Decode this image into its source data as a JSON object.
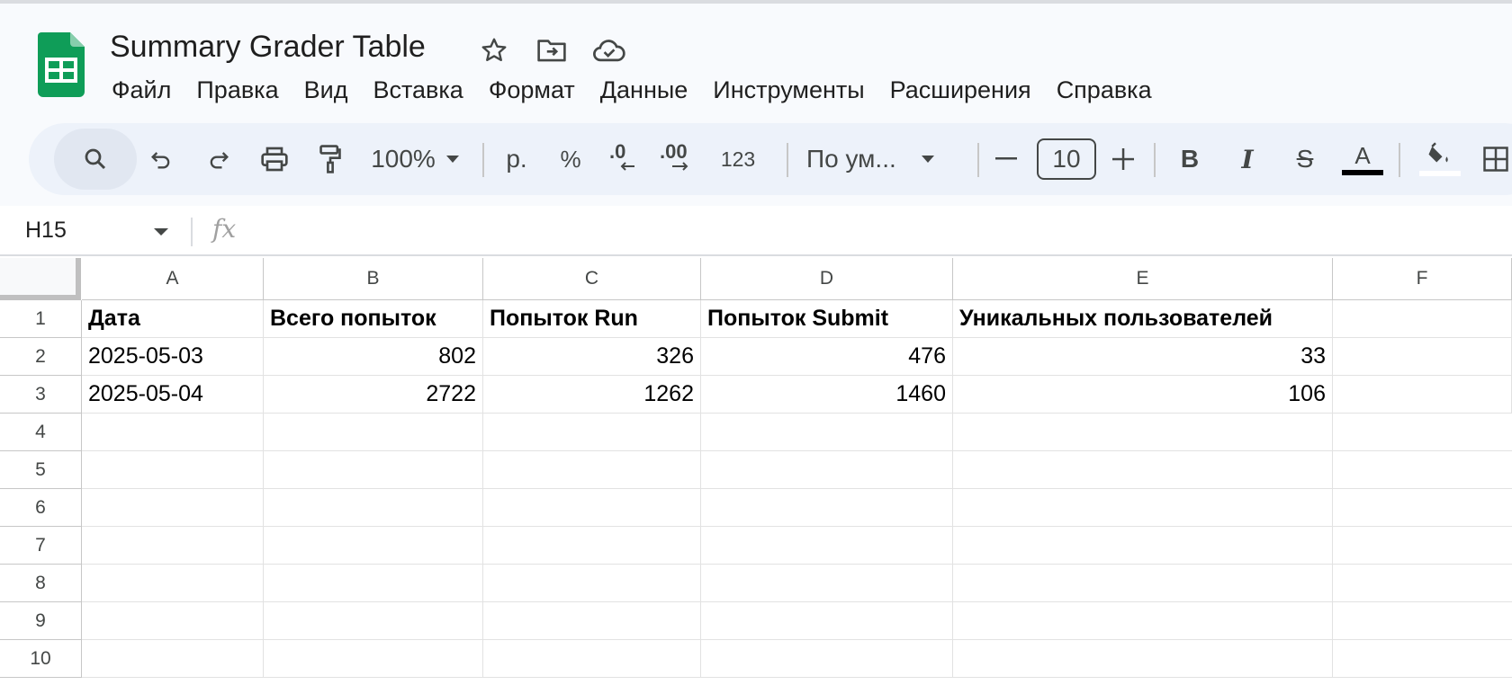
{
  "doc": {
    "title": "Summary Grader Table"
  },
  "title_icons": [
    "star-icon",
    "move-to-folder-icon",
    "cloud-saved-icon"
  ],
  "menu": [
    "Файл",
    "Правка",
    "Вид",
    "Вставка",
    "Формат",
    "Данные",
    "Инструменты",
    "Расширения",
    "Справка"
  ],
  "toolbar": {
    "zoom": "100%",
    "currency": "р.",
    "percent": "%",
    "decrease_decimal": ".0",
    "increase_decimal": ".00",
    "number_format": "123",
    "font": "По ум...",
    "font_size": "10",
    "bold": "B",
    "italic": "I",
    "strike": "S",
    "text_color_label": "A",
    "text_color": "#000000",
    "fill_color": "#ffffff"
  },
  "formula_bar": {
    "cell_ref": "H15",
    "fx": "fx",
    "value": ""
  },
  "sheet": {
    "columns": [
      "A",
      "B",
      "C",
      "D",
      "E",
      "F"
    ],
    "rows": [
      "1",
      "2",
      "3",
      "4",
      "5",
      "6",
      "7",
      "8",
      "9",
      "10"
    ],
    "header_row": [
      "Дата",
      "Всего попыток",
      "Попыток Run",
      "Попыток Submit",
      "Уникальных пользователей"
    ],
    "data": [
      [
        "2025-05-03",
        "802",
        "326",
        "476",
        "33"
      ],
      [
        "2025-05-04",
        "2722",
        "1262",
        "1460",
        "106"
      ]
    ]
  },
  "colors": {
    "header_bg": "#f8fafd",
    "toolbar_bg": "#edf2fa",
    "sheets_green": "#0f9d58"
  }
}
